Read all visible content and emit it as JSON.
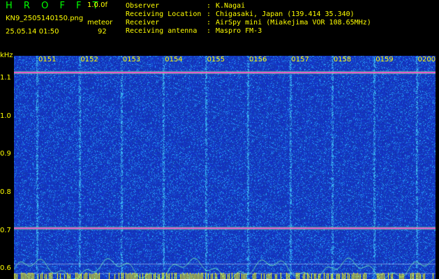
{
  "header": {
    "app_title": "H R O F F T",
    "version": "1.0.0f",
    "filename": "KN9_2505140150.png",
    "meteor_label": "meteor",
    "meteor_count": "92",
    "timestamp": "25.05.14 01:50"
  },
  "info": [
    {
      "label": "Observer",
      "value": "K.Nagai"
    },
    {
      "label": "Receiving Location",
      "value": "Chigasaki, Japan (139.414 35.340)"
    },
    {
      "label": "Receiver",
      "value": "AirSpy mini (Miakejima VOR 108.65MHz)"
    },
    {
      "label": "Receiving antenna",
      "value": "Maspro FM-3"
    }
  ],
  "chart_data": {
    "type": "heatmap",
    "y_unit": "kHz",
    "y_ticks": [
      "1.1",
      "1.0",
      "0.9",
      "0.8",
      "0.7",
      "0.6"
    ],
    "x_ticks": [
      "0151",
      "0152",
      "0153",
      "0154",
      "0155",
      "0156",
      "0157",
      "0158",
      "0159",
      "0200"
    ],
    "ylim": [
      0.575,
      1.16
    ],
    "signal_lines_khz": [
      1.116,
      0.708
    ],
    "colors": {
      "background": "#000000",
      "field": "#1a2db0",
      "noise": "#3fa0ff",
      "text": "#ffff00",
      "signal": "#ff4fd8",
      "marker": "#ffff00"
    }
  }
}
